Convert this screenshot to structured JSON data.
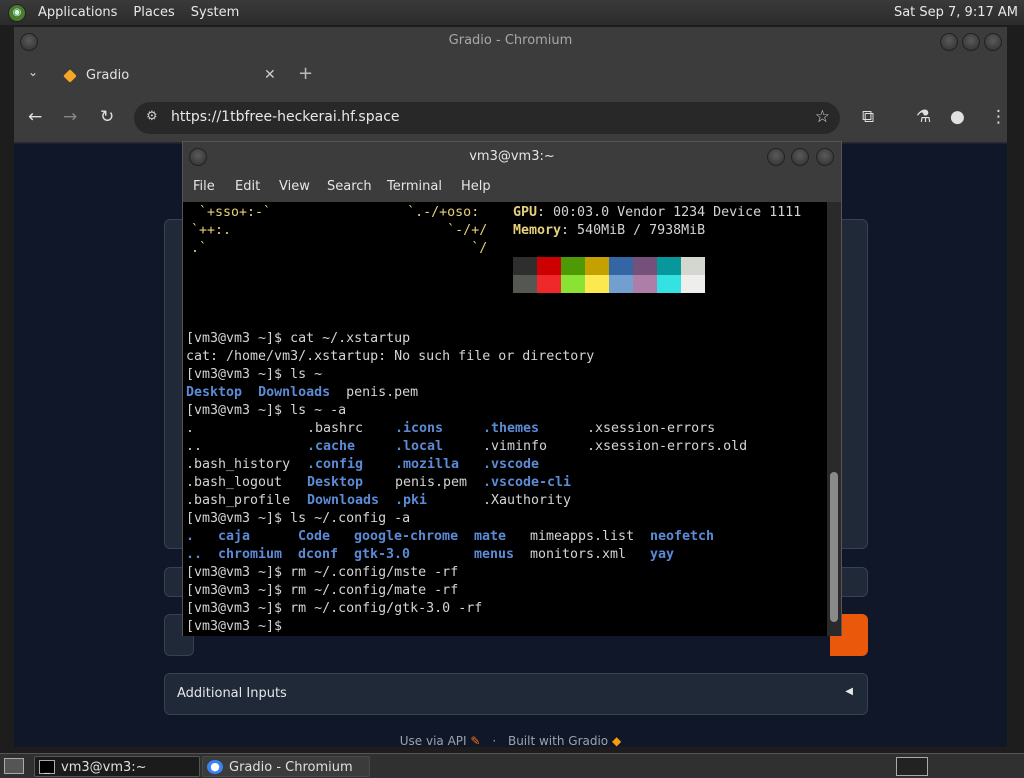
{
  "top_panel": {
    "menus": [
      "Applications",
      "Places",
      "System"
    ],
    "clock": "Sat Sep  7, 9:17 AM"
  },
  "browser": {
    "window_title": "Gradio - Chromium",
    "tab_title": "Gradio",
    "url": "https://1tbfree-heckerai.hf.space"
  },
  "gradio": {
    "additional_inputs": "Additional Inputs",
    "footer_api": "Use via API",
    "footer_built": "Built with Gradio",
    "accent_color": "#ea580c"
  },
  "terminal": {
    "title": "vm3@vm3:~",
    "menu": [
      "File",
      "Edit",
      "View",
      "Search",
      "Terminal",
      "Help"
    ],
    "neofetch_art": [
      " `+sso+:-`                 `.-/+oso:",
      "`++:.                           `-/+/",
      ".`                                 `/"
    ],
    "gpu_label": "GPU",
    "gpu_value": ": 00:03.0 Vendor 1234 Device 1111",
    "memory_label": "Memory",
    "memory_value": ": 540MiB / 7938MiB",
    "palette_top": [
      "#2e2e2e",
      "#cc0000",
      "#4e9a06",
      "#c4a000",
      "#3465a4",
      "#75507b",
      "#06989a",
      "#d3d7cf"
    ],
    "palette_bottom": [
      "#555753",
      "#ef2929",
      "#8ae234",
      "#fce94f",
      "#729fcf",
      "#ad7fa8",
      "#34e2e2",
      "#eeeeec"
    ],
    "prompt": "[vm3@vm3 ~]$",
    "lines": {
      "cmd1": " cat ~/.xstartup",
      "err1": "cat: /home/vm3/.xstartup: No such file or directory",
      "cmd2": " ls ~",
      "cmd3": " ls ~ -a",
      "cmd4": " ls ~/.config -a",
      "cmd5": " rm ~/.config/mste -rf",
      "cmd6": " rm ~/.config/mate -rf",
      "cmd7": " rm ~/.config/gtk-3.0 -rf",
      "cmd8": ""
    },
    "ls_home": [
      {
        "text": "Desktop",
        "dir": true
      },
      {
        "text": "Downloads",
        "dir": true
      },
      {
        "text": "penis.pem",
        "dir": false
      }
    ],
    "ls_all": [
      [
        {
          "text": ".",
          "dir": false
        },
        {
          "text": ".bashrc",
          "dir": false
        },
        {
          "text": ".icons",
          "dir": true
        },
        {
          "text": ".themes",
          "dir": true
        },
        {
          "text": ".xsession-errors",
          "dir": false
        }
      ],
      [
        {
          "text": "..",
          "dir": false
        },
        {
          "text": ".cache",
          "dir": true
        },
        {
          "text": ".local",
          "dir": true
        },
        {
          "text": ".viminfo",
          "dir": false
        },
        {
          "text": ".xsession-errors.old",
          "dir": false
        }
      ],
      [
        {
          "text": ".bash_history",
          "dir": false
        },
        {
          "text": ".config",
          "dir": true
        },
        {
          "text": ".mozilla",
          "dir": true
        },
        {
          "text": ".vscode",
          "dir": true
        }
      ],
      [
        {
          "text": ".bash_logout",
          "dir": false
        },
        {
          "text": "Desktop",
          "dir": true
        },
        {
          "text": "penis.pem",
          "dir": false
        },
        {
          "text": ".vscode-cli",
          "dir": true
        }
      ],
      [
        {
          "text": ".bash_profile",
          "dir": false
        },
        {
          "text": "Downloads",
          "dir": true
        },
        {
          "text": ".pki",
          "dir": true
        },
        {
          "text": ".Xauthority",
          "dir": false
        }
      ]
    ],
    "ls_config": [
      [
        {
          "text": ".",
          "dir": true
        },
        {
          "text": "caja",
          "dir": true
        },
        {
          "text": "Code",
          "dir": true
        },
        {
          "text": "google-chrome",
          "dir": true
        },
        {
          "text": "mate",
          "dir": true
        },
        {
          "text": "mimeapps.list",
          "dir": false
        },
        {
          "text": "neofetch",
          "dir": true
        }
      ],
      [
        {
          "text": "..",
          "dir": true
        },
        {
          "text": "chromium",
          "dir": true
        },
        {
          "text": "dconf",
          "dir": true
        },
        {
          "text": "gtk-3.0",
          "dir": true
        },
        {
          "text": "menus",
          "dir": true
        },
        {
          "text": "monitors.xml",
          "dir": false
        },
        {
          "text": "yay",
          "dir": true
        }
      ]
    ]
  },
  "taskbar": {
    "items": [
      "vm3@vm3:~",
      "Gradio - Chromium"
    ]
  }
}
